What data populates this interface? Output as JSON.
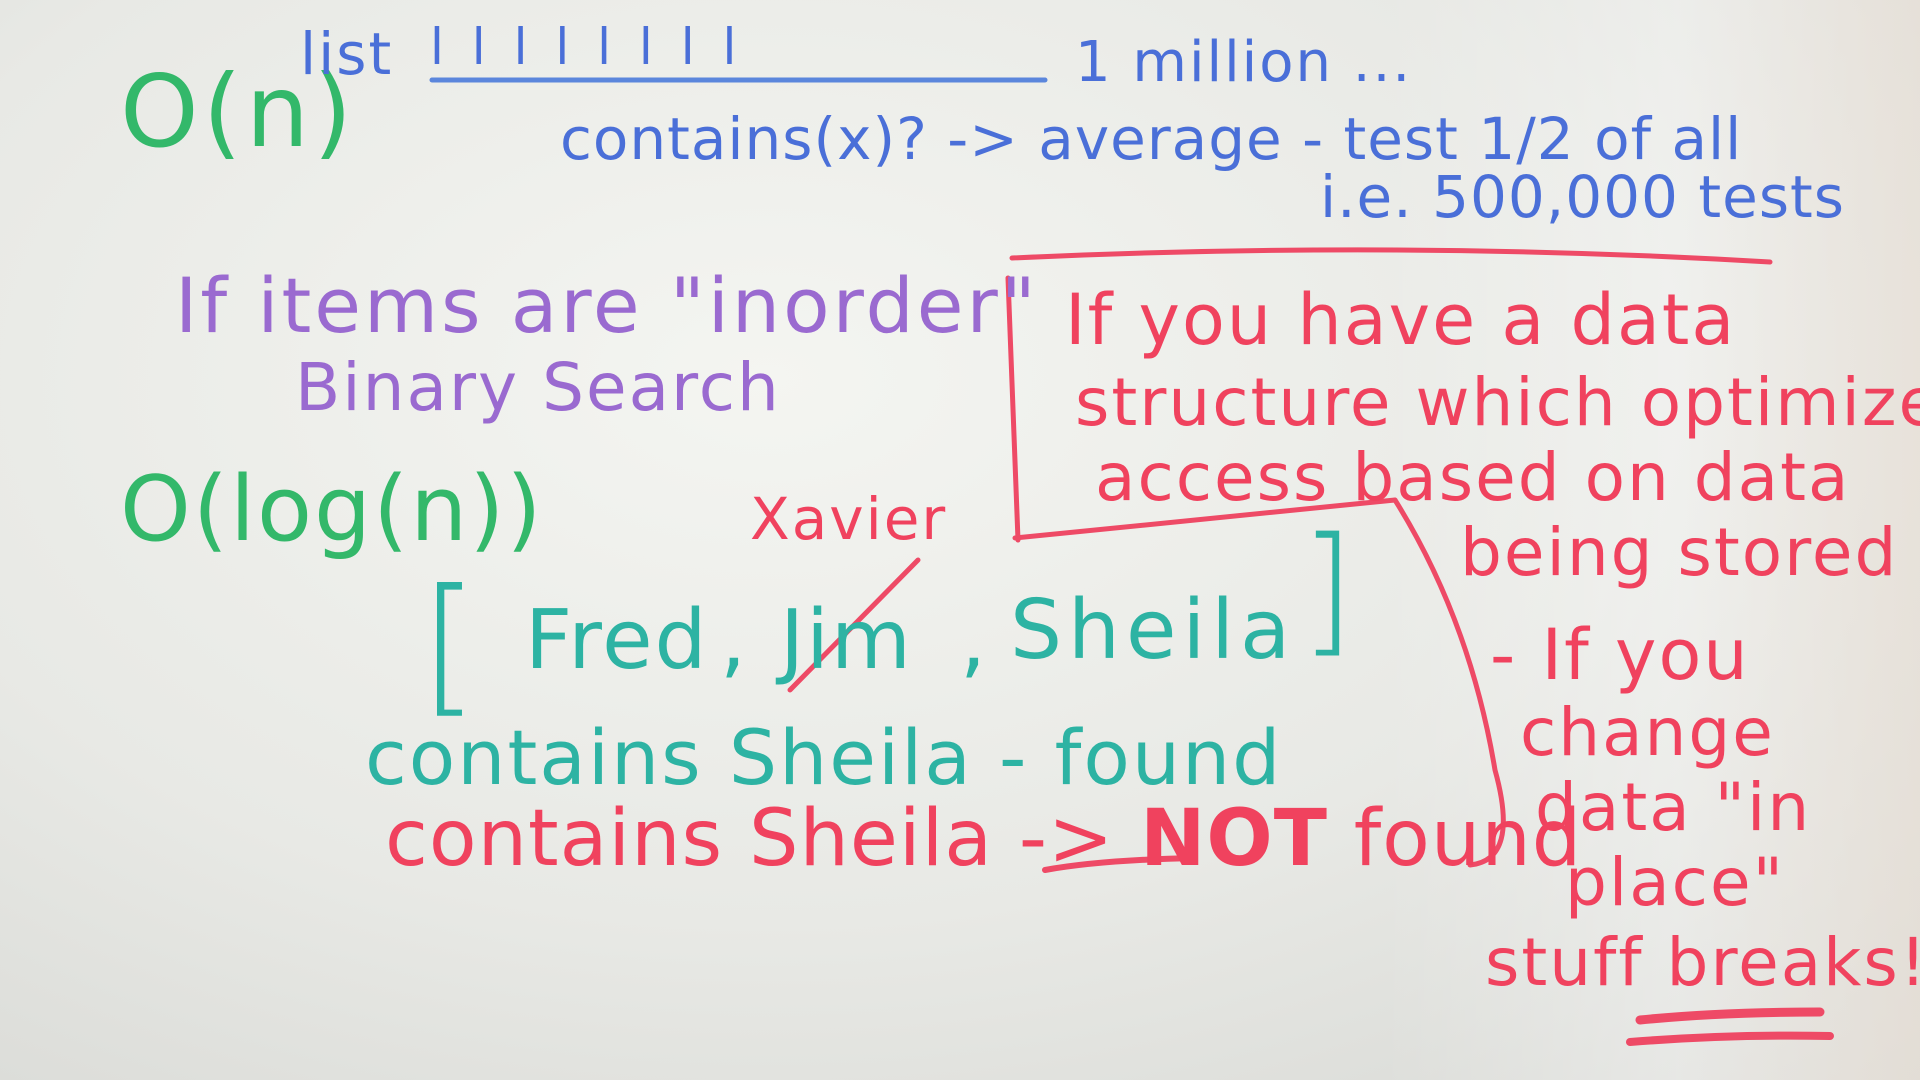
{
  "board": {
    "top_left": {
      "big_o_n": "O(n)",
      "list_label": "list",
      "ticks": "l l l l l l l l",
      "million": "1 million ...",
      "contains_line": "contains(x)? -> average - test 1/2 of all",
      "ie_line": "i.e. 500,000 tests"
    },
    "middle_left": {
      "if_items": "If items are \"inorder\"",
      "binary_search": "Binary Search",
      "big_o_log": "O(log(n))"
    },
    "example": {
      "xavier": "Xavier",
      "open_bracket": "[",
      "fred": "Fred",
      "comma1": ",",
      "jim": "Jim",
      "comma2": ",",
      "sheila": "Sheila",
      "close_bracket": "]",
      "found_line": "contains Sheila - found",
      "not_found_prefix": "contains Sheila -> ",
      "not_word": "NOT",
      "not_found_suffix": " found"
    },
    "box_note": {
      "line1": "If you have a data",
      "line2": "structure which optimizes",
      "line3": "access based on data",
      "line4": "being stored"
    },
    "right_note": {
      "line1": "- If you",
      "line2": "change",
      "line3": "data \"in",
      "line4": "place\"",
      "line5": "stuff breaks!!"
    },
    "colors": {
      "green": "#33b86a",
      "blue": "#4a6fd8",
      "purple": "#9a6ad0",
      "teal": "#2db3a3",
      "red": "#f0425e"
    }
  }
}
